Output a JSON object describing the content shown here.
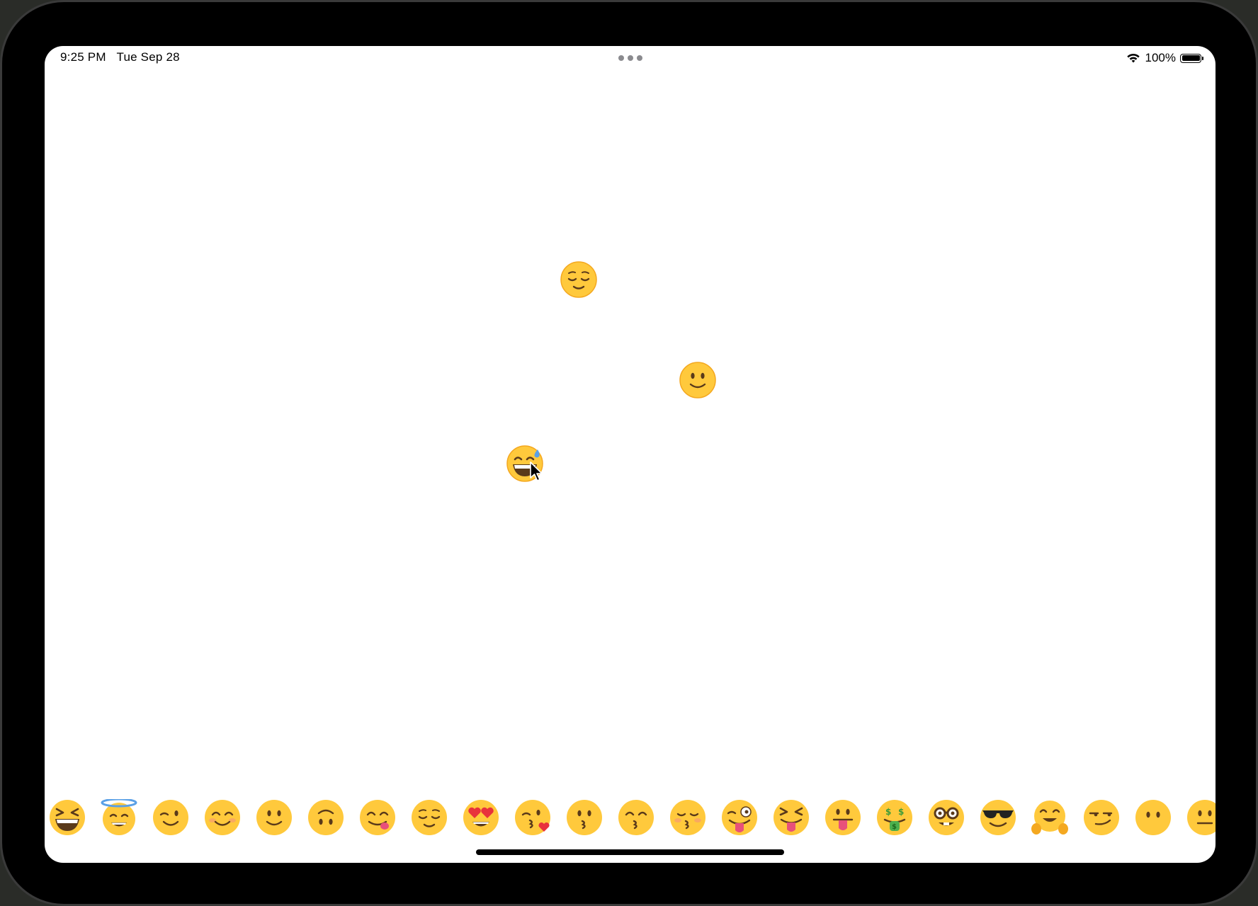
{
  "status_bar": {
    "time": "9:25 PM",
    "date": "Tue Sep 28",
    "battery": "100%",
    "icons": [
      "wifi-icon",
      "battery-icon",
      "multitasking-dots-icon"
    ]
  },
  "canvas": {
    "placed_emojis": [
      {
        "name": "relieved-face-icon"
      },
      {
        "name": "slightly-smiling-face-icon"
      },
      {
        "name": "grinning-face-with-sweat-icon"
      }
    ],
    "pointer": "cursor-arrow-icon"
  },
  "emoji_picker": {
    "items": [
      "grinning-squinting-face-icon",
      "smiling-face-with-halo-icon",
      "winking-face-icon",
      "smiling-face-with-smiling-eyes-icon",
      "slightly-smiling-face-icon",
      "upside-down-face-icon",
      "face-savoring-food-icon",
      "relieved-face-icon",
      "smiling-face-with-heart-eyes-icon",
      "face-blowing-a-kiss-icon",
      "kissing-face-icon",
      "kissing-face-with-smiling-eyes-icon",
      "kissing-face-with-closed-eyes-icon",
      "zany-face-icon",
      "squinting-face-with-tongue-icon",
      "face-with-tongue-icon",
      "money-mouth-face-icon",
      "nerd-face-icon",
      "smiling-face-with-sunglasses-icon",
      "hugging-face-icon",
      "smirking-face-icon",
      "face-without-mouth-icon",
      "neutral-face-icon"
    ]
  },
  "colors": {
    "emoji_face": "#FFC93C",
    "emoji_shadow": "#F4A820",
    "feature": "#5A3A1A",
    "tongue": "#E8507A",
    "heart": "#E8323C",
    "halo": "#5AA0E6",
    "home_indicator": "#000000"
  }
}
